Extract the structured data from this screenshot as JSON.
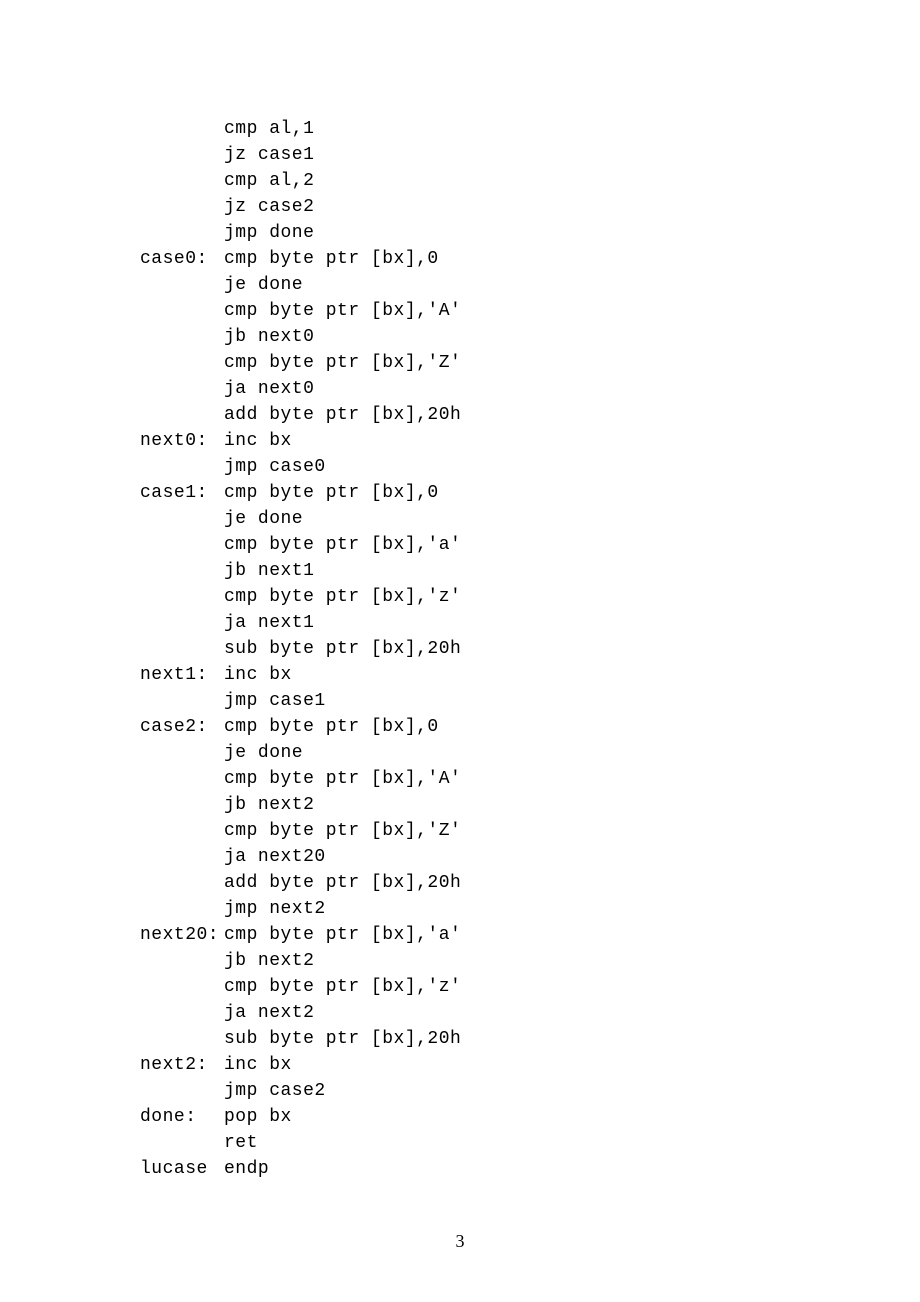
{
  "code": {
    "lines": [
      {
        "label": "",
        "instr": "cmp al,1"
      },
      {
        "label": "",
        "instr": "jz case1"
      },
      {
        "label": "",
        "instr": "cmp al,2"
      },
      {
        "label": "",
        "instr": "jz case2"
      },
      {
        "label": "",
        "instr": "jmp done"
      },
      {
        "label": "case0:",
        "instr": "cmp byte ptr [bx],0"
      },
      {
        "label": "",
        "instr": "je done"
      },
      {
        "label": "",
        "instr": "cmp byte ptr [bx],'A'"
      },
      {
        "label": "",
        "instr": "jb next0"
      },
      {
        "label": "",
        "instr": "cmp byte ptr [bx],'Z'"
      },
      {
        "label": "",
        "instr": "ja next0"
      },
      {
        "label": "",
        "instr": "add byte ptr [bx],20h"
      },
      {
        "label": "next0:",
        "instr": "inc bx"
      },
      {
        "label": "",
        "instr": "jmp case0"
      },
      {
        "label": "case1:",
        "instr": "cmp byte ptr [bx],0"
      },
      {
        "label": "",
        "instr": "je done"
      },
      {
        "label": "",
        "instr": "cmp byte ptr [bx],'a'"
      },
      {
        "label": "",
        "instr": "jb next1"
      },
      {
        "label": "",
        "instr": "cmp byte ptr [bx],'z'"
      },
      {
        "label": "",
        "instr": "ja next1"
      },
      {
        "label": "",
        "instr": "sub byte ptr [bx],20h"
      },
      {
        "label": "next1:",
        "instr": "inc bx"
      },
      {
        "label": "",
        "instr": "jmp case1"
      },
      {
        "label": "case2:",
        "instr": "cmp byte ptr [bx],0"
      },
      {
        "label": "",
        "instr": "je done"
      },
      {
        "label": "",
        "instr": "cmp byte ptr [bx],'A'"
      },
      {
        "label": "",
        "instr": "jb next2"
      },
      {
        "label": "",
        "instr": "cmp byte ptr [bx],'Z'"
      },
      {
        "label": "",
        "instr": "ja next20"
      },
      {
        "label": "",
        "instr": "add byte ptr [bx],20h"
      },
      {
        "label": "",
        "instr": "jmp next2"
      },
      {
        "label": "next20:",
        "instr": "cmp byte ptr [bx],'a'"
      },
      {
        "label": "",
        "instr": "jb next2"
      },
      {
        "label": "",
        "instr": "cmp byte ptr [bx],'z'"
      },
      {
        "label": "",
        "instr": "ja next2"
      },
      {
        "label": "",
        "instr": "sub byte ptr [bx],20h"
      },
      {
        "label": "next2:",
        "instr": "inc bx"
      },
      {
        "label": "",
        "instr": "jmp case2"
      },
      {
        "label": "done:",
        "instr": "pop bx"
      },
      {
        "label": "",
        "instr": "ret"
      },
      {
        "label": "lucase",
        "instr": "endp"
      }
    ]
  },
  "page_number": "3"
}
